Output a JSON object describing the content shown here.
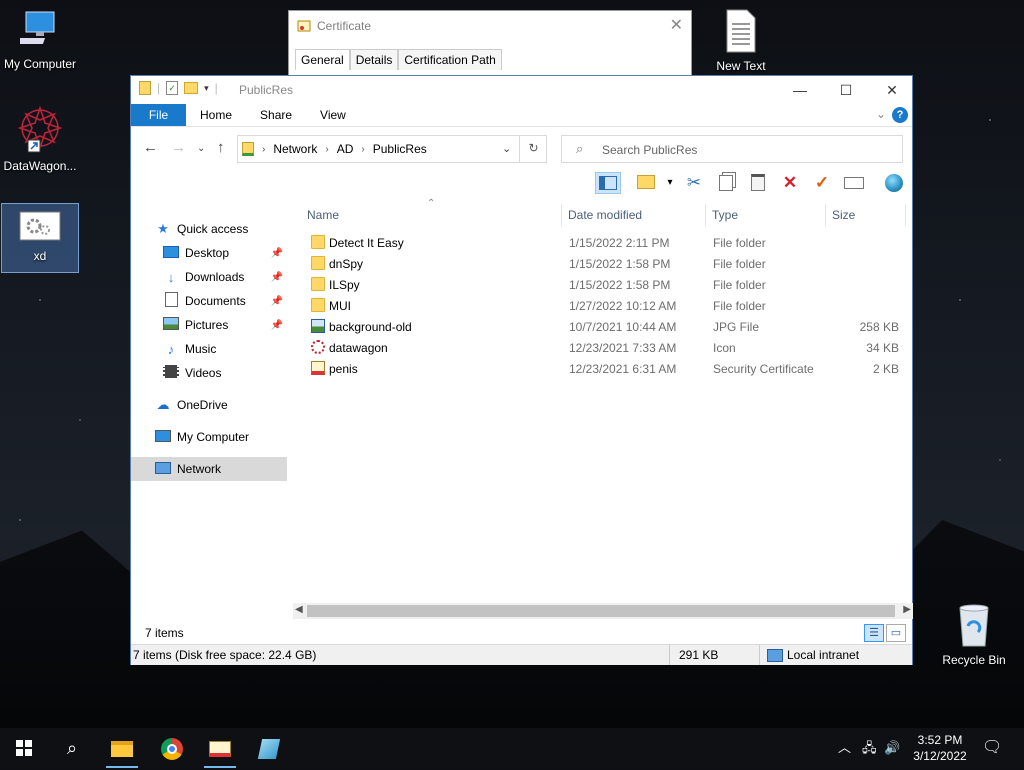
{
  "desktop": {
    "icons": [
      {
        "label": "My Computer"
      },
      {
        "label": "DataWagon..."
      },
      {
        "label": "xd"
      },
      {
        "label": "New Text"
      },
      {
        "label": "Recycle Bin"
      }
    ]
  },
  "certificate_window": {
    "title": "Certificate",
    "tabs": [
      "General",
      "Details",
      "Certification Path"
    ]
  },
  "explorer": {
    "title": "PublicRes",
    "ribbon_tabs": [
      "File",
      "Home",
      "Share",
      "View"
    ],
    "help_label": "?",
    "breadcrumb": [
      "Network",
      "AD",
      "PublicRes"
    ],
    "search_placeholder": "Search PublicRes",
    "nav": {
      "quick_access": "Quick access",
      "pinned": [
        "Desktop",
        "Downloads",
        "Documents",
        "Pictures"
      ],
      "unpinned": [
        "Music",
        "Videos"
      ],
      "onedrive": "OneDrive",
      "my_computer": "My Computer",
      "network": "Network"
    },
    "columns": {
      "name": "Name",
      "date": "Date modified",
      "type": "Type",
      "size": "Size"
    },
    "files": [
      {
        "name": "Detect It Easy",
        "date": "1/15/2022 2:11 PM",
        "type": "File folder",
        "size": "",
        "icon": "folder-icon"
      },
      {
        "name": "dnSpy",
        "date": "1/15/2022 1:58 PM",
        "type": "File folder",
        "size": "",
        "icon": "folder-icon"
      },
      {
        "name": "ILSpy",
        "date": "1/15/2022 1:58 PM",
        "type": "File folder",
        "size": "",
        "icon": "folder-icon"
      },
      {
        "name": "MUI",
        "date": "1/27/2022 10:12 AM",
        "type": "File folder",
        "size": "",
        "icon": "folder-icon"
      },
      {
        "name": "background-old",
        "date": "10/7/2021 10:44 AM",
        "type": "JPG File",
        "size": "258 KB",
        "icon": "image-file-icon"
      },
      {
        "name": "datawagon",
        "date": "12/23/2021 7:33 AM",
        "type": "Icon",
        "size": "34 KB",
        "icon": "icon-file-icon"
      },
      {
        "name": "penis",
        "date": "12/23/2021 6:31 AM",
        "type": "Security Certificate",
        "size": "2 KB",
        "icon": "certificate-file-icon"
      }
    ],
    "status_items": "7 items",
    "status_bottom_left": "7 items (Disk free space: 22.4 GB)",
    "status_bottom_size": "291 KB",
    "status_bottom_zone": "Local intranet"
  },
  "taskbar": {
    "time": "3:52 PM",
    "date": "3/12/2022"
  },
  "colors": {
    "accent": "#1979ca",
    "selection": "#cce4f7",
    "folder": "#ffd868"
  }
}
